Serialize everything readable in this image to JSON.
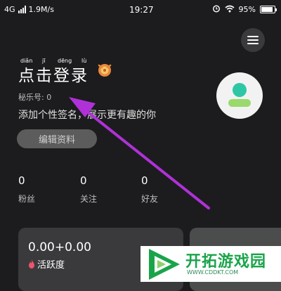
{
  "status_bar": {
    "network": "4G",
    "speed": "1.9M/s",
    "time": "19:27",
    "battery": "95%",
    "battery_level": 0.95
  },
  "profile": {
    "title_pinyin": [
      "diǎn",
      "jī",
      "dēng",
      "lù"
    ],
    "title": "点击登录",
    "account_id": "秘乐号: 0",
    "bio": "添加个性签名，展示更有趣的你",
    "edit_button": "编辑资料"
  },
  "stats": [
    {
      "value": "0",
      "label": "粉丝"
    },
    {
      "value": "0",
      "label": "关注"
    },
    {
      "value": "0",
      "label": "好友"
    }
  ],
  "activity_card": {
    "value": "0.00+0.00",
    "label": "活跃度"
  },
  "watermark": {
    "title": "开拓游戏园",
    "url": "WWW.CDDKT.COM"
  },
  "colors": {
    "background": "#1c1c1e",
    "arrow": "#b031d8",
    "watermark_green": "#1aa44a",
    "avatar_teal": "#2ec7a6",
    "avatar_green": "#9ad96b"
  }
}
